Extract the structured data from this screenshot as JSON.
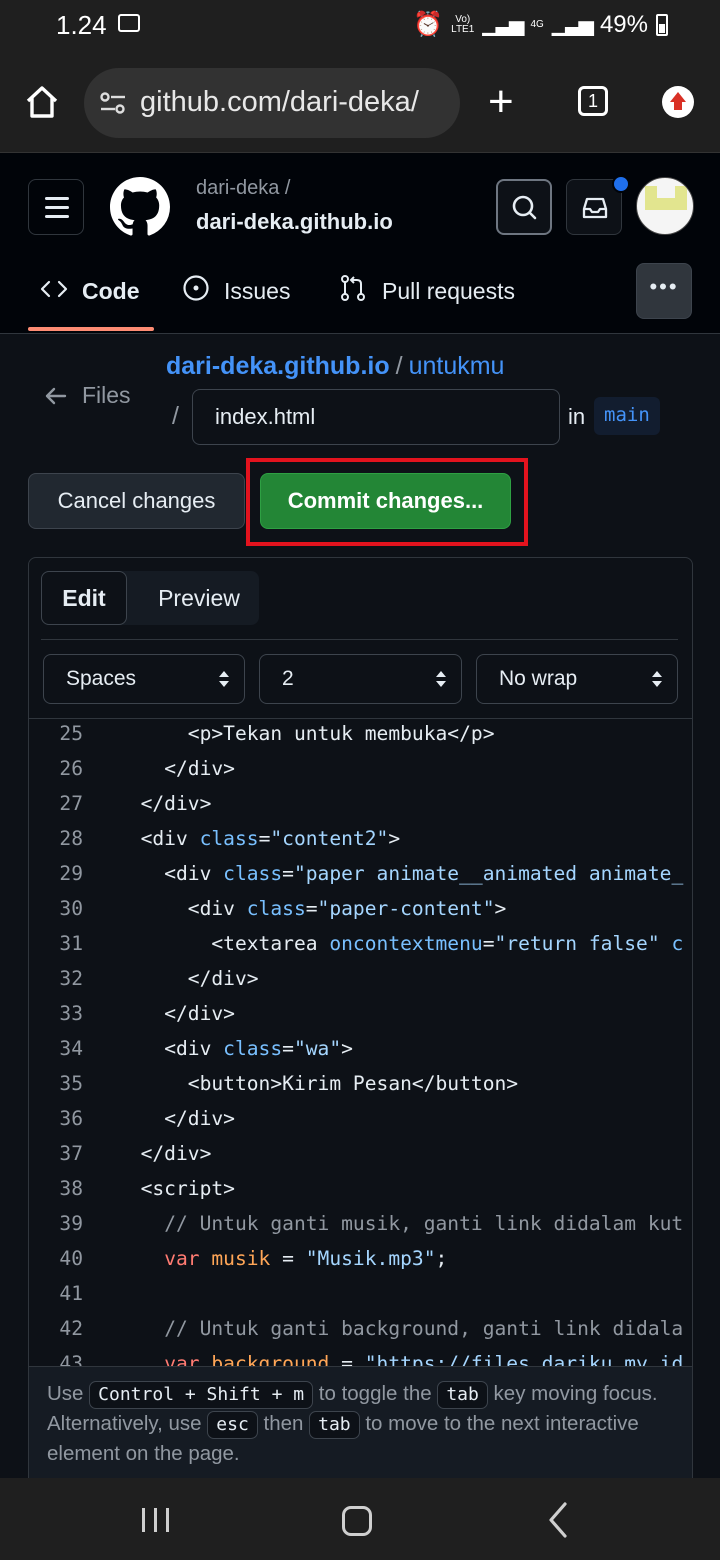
{
  "status_bar": {
    "time": "1.24",
    "volte": "Vo)",
    "lte": "LTE1",
    "net": "4G",
    "battery": "49%"
  },
  "browser": {
    "url": "github.com/dari-deka/",
    "tab_count": "1"
  },
  "github": {
    "owner": "dari-deka /",
    "repo": "dari-deka.github.io",
    "nav": {
      "code": "Code",
      "issues": "Issues",
      "pulls": "Pull requests"
    }
  },
  "editor_header": {
    "files_label": "Files",
    "repo_link": "dari-deka.github.io",
    "sep": "/",
    "dir_link": "untukmu",
    "sep2": "/",
    "filename": "index.html",
    "in_label": "in",
    "branch": "main"
  },
  "actions": {
    "cancel": "Cancel changes",
    "commit": "Commit changes..."
  },
  "editor": {
    "tabs": {
      "edit": "Edit",
      "preview": "Preview"
    },
    "indent_mode": "Spaces",
    "indent_size": "2",
    "wrap_mode": "No wrap",
    "lines": [
      {
        "n": "25",
        "indent": "      ",
        "parts": [
          {
            "t": "<p>Tekan untuk membuka</p>",
            "c": ""
          }
        ]
      },
      {
        "n": "26",
        "indent": "    ",
        "parts": [
          {
            "t": "</div>",
            "c": ""
          }
        ]
      },
      {
        "n": "27",
        "indent": "  ",
        "parts": [
          {
            "t": "</div>",
            "c": ""
          }
        ]
      },
      {
        "n": "28",
        "indent": "  ",
        "parts": [
          {
            "t": "<div ",
            "c": ""
          },
          {
            "t": "class",
            "c": "attr"
          },
          {
            "t": "=",
            "c": ""
          },
          {
            "t": "\"content2\"",
            "c": "str"
          },
          {
            "t": ">",
            "c": ""
          }
        ]
      },
      {
        "n": "29",
        "indent": "    ",
        "parts": [
          {
            "t": "<div ",
            "c": ""
          },
          {
            "t": "class",
            "c": "attr"
          },
          {
            "t": "=",
            "c": ""
          },
          {
            "t": "\"paper animate__animated animate_",
            "c": "str"
          }
        ]
      },
      {
        "n": "30",
        "indent": "      ",
        "parts": [
          {
            "t": "<div ",
            "c": ""
          },
          {
            "t": "class",
            "c": "attr"
          },
          {
            "t": "=",
            "c": ""
          },
          {
            "t": "\"paper-content\"",
            "c": "str"
          },
          {
            "t": ">",
            "c": ""
          }
        ]
      },
      {
        "n": "31",
        "indent": "        ",
        "parts": [
          {
            "t": "<textarea ",
            "c": ""
          },
          {
            "t": "oncontextmenu",
            "c": "attr"
          },
          {
            "t": "=",
            "c": ""
          },
          {
            "t": "\"return false\"",
            "c": "str"
          },
          {
            "t": " c",
            "c": "attr"
          }
        ]
      },
      {
        "n": "32",
        "indent": "      ",
        "parts": [
          {
            "t": "</div>",
            "c": ""
          }
        ]
      },
      {
        "n": "33",
        "indent": "    ",
        "parts": [
          {
            "t": "</div>",
            "c": ""
          }
        ]
      },
      {
        "n": "34",
        "indent": "    ",
        "parts": [
          {
            "t": "<div ",
            "c": ""
          },
          {
            "t": "class",
            "c": "attr"
          },
          {
            "t": "=",
            "c": ""
          },
          {
            "t": "\"wa\"",
            "c": "str"
          },
          {
            "t": ">",
            "c": ""
          }
        ]
      },
      {
        "n": "35",
        "indent": "      ",
        "parts": [
          {
            "t": "<button>Kirim Pesan</button>",
            "c": ""
          }
        ]
      },
      {
        "n": "36",
        "indent": "    ",
        "parts": [
          {
            "t": "</div>",
            "c": ""
          }
        ]
      },
      {
        "n": "37",
        "indent": "  ",
        "parts": [
          {
            "t": "</div>",
            "c": ""
          }
        ]
      },
      {
        "n": "38",
        "indent": "  ",
        "parts": [
          {
            "t": "<script>",
            "c": ""
          }
        ]
      },
      {
        "n": "39",
        "indent": "    ",
        "parts": [
          {
            "t": "// Untuk ganti musik, ganti link didalam kut",
            "c": "cmt"
          }
        ]
      },
      {
        "n": "40",
        "indent": "    ",
        "parts": [
          {
            "t": "var ",
            "c": "kw"
          },
          {
            "t": "musik",
            "c": "var"
          },
          {
            "t": " = ",
            "c": ""
          },
          {
            "t": "\"Musik.mp3\"",
            "c": "str"
          },
          {
            "t": ";",
            "c": ""
          }
        ]
      },
      {
        "n": "41",
        "indent": "",
        "parts": []
      },
      {
        "n": "42",
        "indent": "    ",
        "parts": [
          {
            "t": "// Untuk ganti background, ganti link didala",
            "c": "cmt"
          }
        ]
      },
      {
        "n": "43",
        "indent": "    ",
        "parts": [
          {
            "t": "var ",
            "c": "kw"
          },
          {
            "t": "background",
            "c": "var"
          },
          {
            "t": " = ",
            "c": ""
          },
          {
            "t": "\"https://files.dariku.my.id",
            "c": "str"
          }
        ]
      }
    ],
    "hint": {
      "use": "Use",
      "key1": "Control + Shift + m",
      "toggle": "to toggle the",
      "key2": "tab",
      "rest1": "key moving focus. Alternatively, use",
      "key3": "esc",
      "then": "then",
      "key4": "tab",
      "rest2": "to move to the next interactive element on the page."
    }
  },
  "colors": {
    "accent_green": "#238636",
    "highlight_red": "#e3131e",
    "link_blue": "#4493f8",
    "tab_underline": "#fd8c73"
  }
}
